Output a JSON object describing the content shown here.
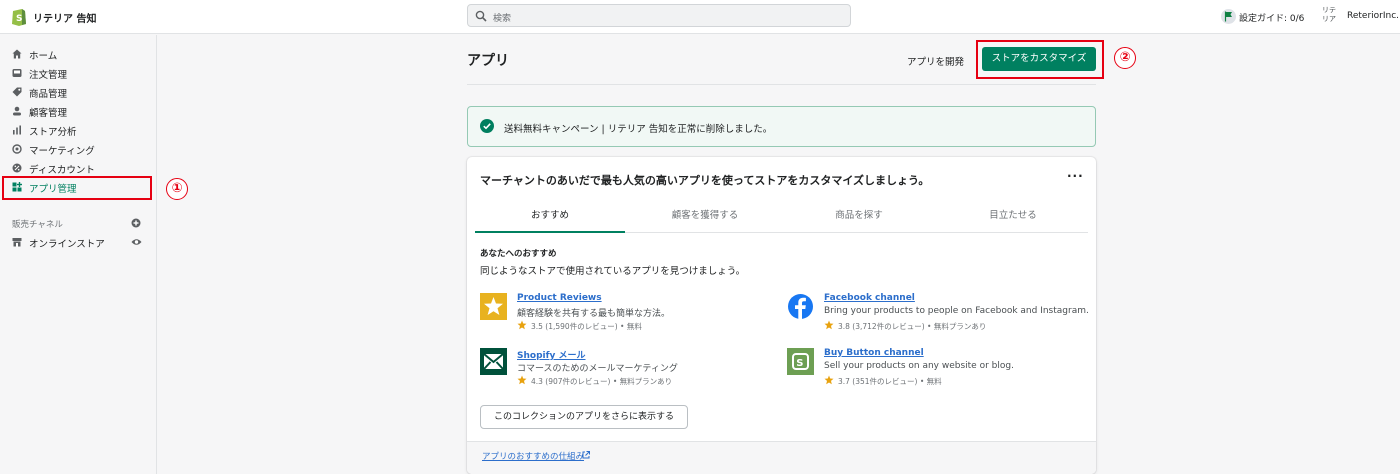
{
  "topbar": {
    "store_name": "リテリア 告知",
    "search_placeholder": "検索",
    "setup_guide": "設定ガイド: 0/6",
    "account_avatar": "リテ リア",
    "account_name": "ReteriorInc."
  },
  "sidebar": {
    "items": [
      {
        "label": "ホーム",
        "icon": "home-icon"
      },
      {
        "label": "注文管理",
        "icon": "inbox-icon"
      },
      {
        "label": "商品管理",
        "icon": "tag-icon"
      },
      {
        "label": "顧客管理",
        "icon": "person-icon"
      },
      {
        "label": "ストア分析",
        "icon": "bar-chart-icon"
      },
      {
        "label": "マーケティング",
        "icon": "target-icon"
      },
      {
        "label": "ディスカウント",
        "icon": "discount-icon"
      },
      {
        "label": "アプリ管理",
        "icon": "apps-icon",
        "active": true
      }
    ],
    "sales_channels_header": "販売チャネル",
    "online_store": "オンラインストア"
  },
  "annotations": {
    "badge_1": "①",
    "badge_2": "②",
    "highlight_color": "#e60012"
  },
  "main": {
    "title": "アプリ",
    "develop_link": "アプリを開発",
    "customize_button": "ストアをカスタマイズ",
    "banner": "送料無料キャンペーン | リテリア 告知を正常に削除しました。",
    "card_heading": "マーチャントのあいだで最も人気の高いアプリを使ってストアをカスタマイズしましょう。",
    "tabs": [
      "おすすめ",
      "顧客を獲得する",
      "商品を探す",
      "目立たせる"
    ],
    "rec_title": "あなたへのおすすめ",
    "rec_desc": "同じようなストアで使用されているアプリを見つけましょう。",
    "apps": [
      {
        "name": "Product Reviews",
        "desc": "顧客経験を共有する最も簡単な方法。",
        "rating": "3.5 (1,590件のレビュー) • 無料",
        "icon": "star-tile-icon"
      },
      {
        "name": "Facebook channel",
        "desc": "Bring your products to people on Facebook and Instagram.",
        "rating": "3.8 (3,712件のレビュー) • 無料プランあり",
        "icon": "facebook-icon"
      },
      {
        "name": "Shopify メール",
        "desc": "コマースのためのメールマーケティング",
        "rating": "4.3 (907件のレビュー) • 無料プランあり",
        "icon": "email-icon"
      },
      {
        "name": "Buy Button channel",
        "desc": "Sell your products on any website or blog.",
        "rating": "3.7 (351件のレビュー) • 無料",
        "icon": "buy-button-icon"
      }
    ],
    "more_button": "このコレクションのアプリをさらに表示する",
    "footer_link": "アプリのおすすめの仕組み"
  },
  "colors": {
    "primary": "#008060",
    "link": "#2c6ecb",
    "banner_bg": "#f1f8f5"
  }
}
